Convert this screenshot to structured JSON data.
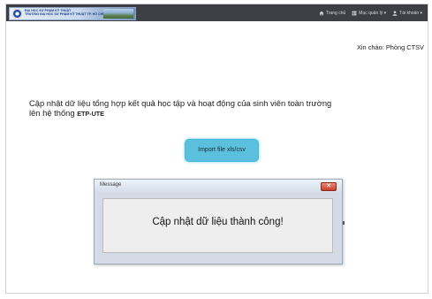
{
  "navbar": {
    "logo_text": [
      "ĐẠI HỌC SƯ PHẠM KỸ THUẬT",
      "TRƯỜNG ĐẠI HỌC SƯ PHẠM KỸ THUẬT TP. HỒ CHÍ MINH"
    ],
    "items": [
      {
        "label": "Trang chủ",
        "icon": "home-icon"
      },
      {
        "label": "Mục quản lý ▾",
        "icon": "grid-icon"
      },
      {
        "label": "Tài khoản ▾",
        "icon": "user-icon"
      }
    ]
  },
  "main": {
    "greeting": "Xin chào: Phòng CTSV",
    "headline_line1": "Cập nhật dữ liệu tổng hợp kết quả học tập và hoạt động của sinh viên toàn trường",
    "headline_line2": "lên hệ thống",
    "system_name": "ETP-UTE",
    "import_button": "Import file xls/csv"
  },
  "dialog": {
    "title": "Message",
    "close_label": "✕",
    "message": "Cập nhật dữ liệu thành công!"
  },
  "colors": {
    "navbar": "#3d3f44",
    "button": "#5bc0de",
    "dialog_frame": "#d4dbe6",
    "close_button": "#c7402a"
  }
}
